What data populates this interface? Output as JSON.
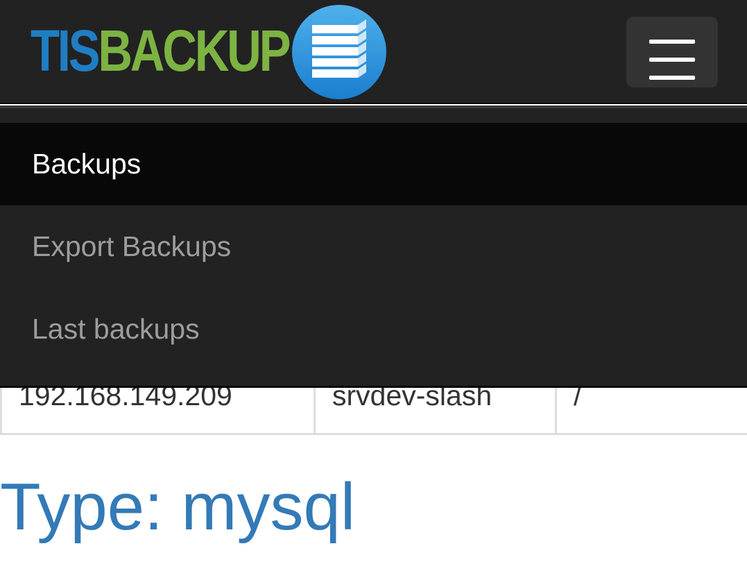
{
  "brand": {
    "part1": "TIS",
    "part2": "BACKUP",
    "logo_icon": "stacked-layers-icon",
    "colors": {
      "tis": "#1f7ec4",
      "backup": "#7cb342",
      "logo_circle": "#2a8fd8"
    }
  },
  "navbar": {
    "toggle_icon": "hamburger-menu-icon"
  },
  "menu": {
    "items": [
      {
        "label": "Backups",
        "active": true
      },
      {
        "label": "Export Backups",
        "active": false
      },
      {
        "label": "Last backups",
        "active": false
      }
    ]
  },
  "table": {
    "row": [
      "192.168.149.209",
      "srvdev-slash",
      "/"
    ]
  },
  "section": {
    "heading": "Type: mysql"
  }
}
